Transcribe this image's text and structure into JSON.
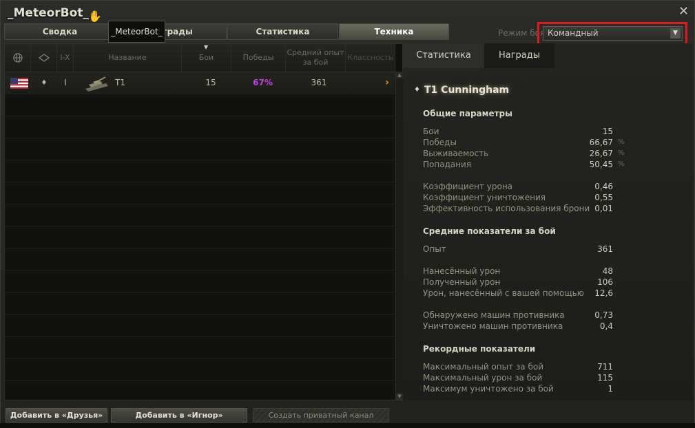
{
  "window": {
    "title": "_MeteorBot_",
    "tooltip": "_MeteorBot_"
  },
  "tabs": [
    {
      "label": "Сводка",
      "active": false
    },
    {
      "label": "Награды",
      "active": false
    },
    {
      "label": "Статистика",
      "active": false
    },
    {
      "label": "Техника",
      "active": true
    }
  ],
  "battle_mode": {
    "label": "Режим боя",
    "value": "Командный"
  },
  "table": {
    "headers": {
      "name": "Название",
      "battles": "Бои",
      "wins": "Победы",
      "avg_exp": "Средний опыт за бой",
      "mastery": "Классность",
      "tier": "I-X"
    },
    "rows": [
      {
        "nation_flag": "usa-flag",
        "type": "♦",
        "tier": "I",
        "name": "T1",
        "battles": "15",
        "wins": "67%",
        "avg_exp": "361",
        "arrow": "›"
      }
    ]
  },
  "right_panel": {
    "tabs": [
      {
        "label": "Статистика",
        "active": true
      },
      {
        "label": "Награды",
        "active": false
      }
    ],
    "vehicle_name": "T1 Cunningham",
    "general": {
      "title": "Общие параметры",
      "rows": [
        {
          "label": "Бои",
          "value": "15",
          "unit": ""
        },
        {
          "label": "Победы",
          "value": "66,67",
          "unit": "%"
        },
        {
          "label": "Выживаемость",
          "value": "26,67",
          "unit": "%"
        },
        {
          "label": "Попадания",
          "value": "50,45",
          "unit": "%"
        }
      ],
      "rows2": [
        {
          "label": "Коэффициент урона",
          "value": "0,46"
        },
        {
          "label": "Коэффициент уничтожения",
          "value": "0,55"
        },
        {
          "label": "Эффективность использования брони",
          "value": "0,01"
        }
      ]
    },
    "average": {
      "title": "Средние показатели за бой",
      "rows": [
        {
          "label": "Опыт",
          "value": "361"
        }
      ],
      "rows2": [
        {
          "label": "Нанесённый урон",
          "value": "48"
        },
        {
          "label": "Полученный урон",
          "value": "106"
        },
        {
          "label": "Урон, нанесённый с вашей помощью",
          "value": "12,6"
        }
      ],
      "rows3": [
        {
          "label": "Обнаружено машин противника",
          "value": "0,73"
        },
        {
          "label": "Уничтожено машин противника",
          "value": "0,4"
        }
      ]
    },
    "records": {
      "title": "Рекордные показатели",
      "rows": [
        {
          "label": "Максимальный опыт за бой",
          "value": "711"
        },
        {
          "label": "Максимальный урон за бой",
          "value": "115"
        },
        {
          "label": "Максимум уничтожено за бой",
          "value": "1"
        }
      ]
    }
  },
  "buttons": {
    "add_friend": "Добавить в «Друзья»",
    "add_ignore": "Добавить в «Игнор»",
    "private_channel": "Создать приватный канал"
  },
  "colors": {
    "wins_highlight": "#c040e0",
    "mode_highlight": "#e01a1a"
  }
}
